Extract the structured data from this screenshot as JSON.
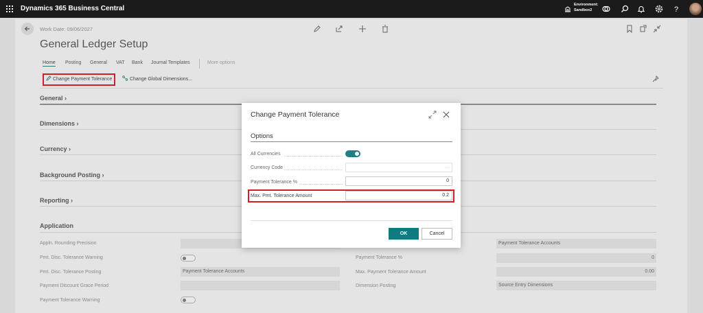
{
  "topbar": {
    "app_title": "Dynamics 365 Business Central",
    "env_label": "Environment:",
    "env_name": "Sandbox2"
  },
  "page": {
    "work_date": "Work Date: 09/06/2027",
    "title": "General Ledger Setup",
    "tabs": [
      "Home",
      "Posting",
      "General",
      "VAT",
      "Bank",
      "Journal Templates"
    ],
    "more_options": "More options",
    "actions": {
      "change_payment_tolerance": "Change Payment Tolerance",
      "change_global_dimensions": "Change Global Dimensions..."
    },
    "sections": [
      "General",
      "Dimensions",
      "Currency",
      "Background Posting",
      "Reporting",
      "Application"
    ],
    "application": {
      "left_fields": [
        {
          "label": "Appln. Rounding Precision",
          "value": ""
        },
        {
          "label": "Pmt. Disc. Tolerance Warning",
          "value": ""
        },
        {
          "label": "Pmt. Disc. Tolerance Posting",
          "value": "Payment Tolerance Accounts"
        },
        {
          "label": "Payment Discount Grace Period",
          "value": ""
        },
        {
          "label": "Payment Tolerance Warning",
          "value": ""
        }
      ],
      "right_fields": [
        {
          "label": "",
          "value": "Payment Tolerance Accounts"
        },
        {
          "label": "Payment Tolerance %",
          "value": "0"
        },
        {
          "label": "Max. Payment Tolerance Amount",
          "value": "0.00"
        },
        {
          "label": "Dimension Posting",
          "value": "Source Entry Dimensions"
        }
      ]
    }
  },
  "dialog": {
    "title": "Change Payment Tolerance",
    "section": "Options",
    "fields": {
      "all_currencies": {
        "label": "All Currencies",
        "value": "on"
      },
      "currency_code": {
        "label": "Currency Code",
        "value": "",
        "lookup": "..."
      },
      "payment_tolerance_pct": {
        "label": "Payment Tolerance %",
        "value": "0"
      },
      "max_pmt_tolerance_amount": {
        "label": "Max. Pmt. Tolerance Amount",
        "value": "0.2"
      }
    },
    "ok_label": "OK",
    "cancel_label": "Cancel"
  },
  "colors": {
    "accent": "#0f7b80",
    "highlight": "#d21f26",
    "topbar": "#1b1b1b"
  }
}
